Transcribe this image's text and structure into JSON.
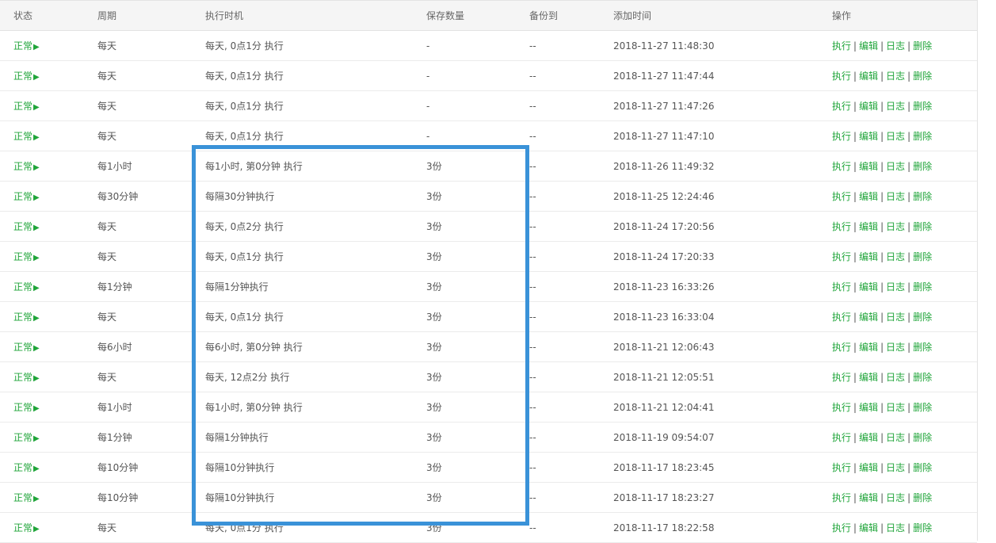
{
  "headers": {
    "status": "状态",
    "period": "周期",
    "exec_time": "执行时机",
    "save_count": "保存数量",
    "backup_to": "备份到",
    "add_time": "添加时间",
    "actions": "操作"
  },
  "action_labels": {
    "run": "执行",
    "edit": "编辑",
    "log": "日志",
    "delete": "删除",
    "sep": "|"
  },
  "status_arrow": "▶",
  "rows": [
    {
      "status": "正常",
      "period": "每天",
      "exec_time": "每天, 0点1分 执行",
      "save_count": "-",
      "backup_to": "--",
      "add_time": "2018-11-27 11:48:30"
    },
    {
      "status": "正常",
      "period": "每天",
      "exec_time": "每天, 0点1分 执行",
      "save_count": "-",
      "backup_to": "--",
      "add_time": "2018-11-27 11:47:44"
    },
    {
      "status": "正常",
      "period": "每天",
      "exec_time": "每天, 0点1分 执行",
      "save_count": "-",
      "backup_to": "--",
      "add_time": "2018-11-27 11:47:26"
    },
    {
      "status": "正常",
      "period": "每天",
      "exec_time": "每天, 0点1分 执行",
      "save_count": "-",
      "backup_to": "--",
      "add_time": "2018-11-27 11:47:10"
    },
    {
      "status": "正常",
      "period": "每1小时",
      "exec_time": "每1小时, 第0分钟 执行",
      "save_count": "3份",
      "backup_to": "--",
      "add_time": "2018-11-26 11:49:32"
    },
    {
      "status": "正常",
      "period": "每30分钟",
      "exec_time": "每隔30分钟执行",
      "save_count": "3份",
      "backup_to": "--",
      "add_time": "2018-11-25 12:24:46"
    },
    {
      "status": "正常",
      "period": "每天",
      "exec_time": "每天, 0点2分 执行",
      "save_count": "3份",
      "backup_to": "--",
      "add_time": "2018-11-24 17:20:56"
    },
    {
      "status": "正常",
      "period": "每天",
      "exec_time": "每天, 0点1分 执行",
      "save_count": "3份",
      "backup_to": "--",
      "add_time": "2018-11-24 17:20:33"
    },
    {
      "status": "正常",
      "period": "每1分钟",
      "exec_time": "每隔1分钟执行",
      "save_count": "3份",
      "backup_to": "--",
      "add_time": "2018-11-23 16:33:26"
    },
    {
      "status": "正常",
      "period": "每天",
      "exec_time": "每天, 0点1分 执行",
      "save_count": "3份",
      "backup_to": "--",
      "add_time": "2018-11-23 16:33:04"
    },
    {
      "status": "正常",
      "period": "每6小时",
      "exec_time": "每6小时, 第0分钟 执行",
      "save_count": "3份",
      "backup_to": "--",
      "add_time": "2018-11-21 12:06:43"
    },
    {
      "status": "正常",
      "period": "每天",
      "exec_time": "每天, 12点2分 执行",
      "save_count": "3份",
      "backup_to": "--",
      "add_time": "2018-11-21 12:05:51"
    },
    {
      "status": "正常",
      "period": "每1小时",
      "exec_time": "每1小时, 第0分钟 执行",
      "save_count": "3份",
      "backup_to": "--",
      "add_time": "2018-11-21 12:04:41"
    },
    {
      "status": "正常",
      "period": "每1分钟",
      "exec_time": "每隔1分钟执行",
      "save_count": "3份",
      "backup_to": "--",
      "add_time": "2018-11-19 09:54:07"
    },
    {
      "status": "正常",
      "period": "每10分钟",
      "exec_time": "每隔10分钟执行",
      "save_count": "3份",
      "backup_to": "--",
      "add_time": "2018-11-17 18:23:45"
    },
    {
      "status": "正常",
      "period": "每10分钟",
      "exec_time": "每隔10分钟执行",
      "save_count": "3份",
      "backup_to": "--",
      "add_time": "2018-11-17 18:23:27"
    },
    {
      "status": "正常",
      "period": "每天",
      "exec_time": "每天, 0点1分 执行",
      "save_count": "3份",
      "backup_to": "--",
      "add_time": "2018-11-17 18:22:58"
    }
  ],
  "colors": {
    "status_green": "#20a53a",
    "link_green": "#20a53a",
    "highlight_blue": "#3a92d8",
    "header_bg": "#f5f5f5"
  }
}
